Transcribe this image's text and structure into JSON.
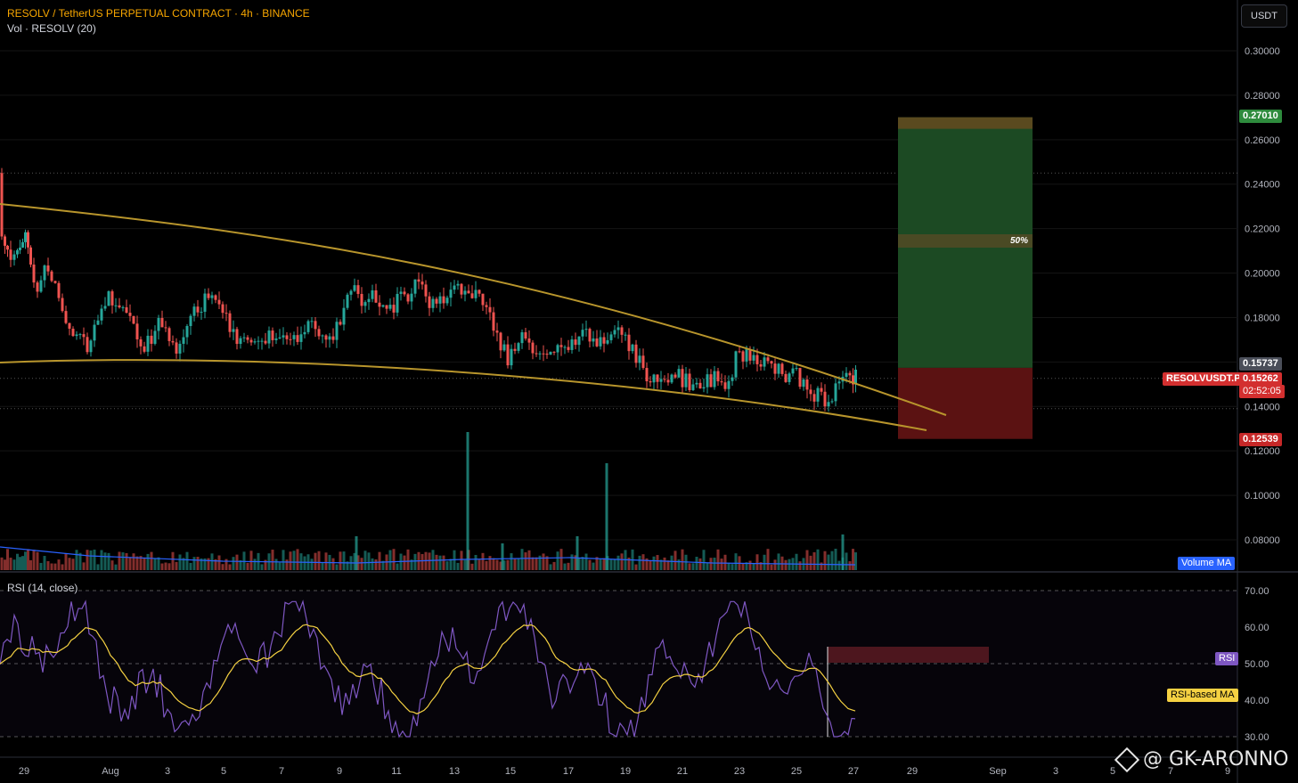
{
  "header": {
    "title": "RESOLV / TetherUS PERPETUAL CONTRACT · 4h · BINANCE",
    "volume_label": "Vol · RESOLV (20)",
    "rsi_label": "RSI (14, close)",
    "unit": "USDT"
  },
  "colors": {
    "up": "#26a69a",
    "down": "#ef5350",
    "trendline": "#b8952c",
    "rsi_line": "#7e57c2",
    "rsi_ma": "#f5d142",
    "target_zone": "#1c4a23",
    "stop_zone": "#5b1212"
  },
  "tags": {
    "target": "0.27010",
    "last_high": "0.15737",
    "symbol": "RESOLVUSDT.P",
    "last_price": "0.15262",
    "countdown": "02:52:05",
    "stop": "0.12539",
    "volume_ma": "Volume MA",
    "rsi": "RSI",
    "rsi_ma": "RSI-based MA",
    "mid_label": "50%"
  },
  "watermark": "@ GK-ARONNO",
  "chart_data": {
    "type": "candlestick",
    "symbol": "RESOLVUSDT.P",
    "interval": "4h",
    "y_ticks": [
      "0.30000",
      "0.28000",
      "0.26000",
      "0.24000",
      "0.22000",
      "0.20000",
      "0.18000",
      "0.16000",
      "0.14000",
      "0.12000",
      "0.10000",
      "0.08000"
    ],
    "ylim": [
      0.07,
      0.31
    ],
    "x_ticks": [
      "29",
      "Aug",
      "3",
      "5",
      "7",
      "9",
      "11",
      "13",
      "15",
      "17",
      "19",
      "21",
      "23",
      "25",
      "27",
      "29",
      "Sep",
      "3",
      "5",
      "7",
      "9"
    ],
    "price_path": [
      [
        0,
        0.245
      ],
      [
        4,
        0.22
      ],
      [
        10,
        0.212
      ],
      [
        18,
        0.205
      ],
      [
        24,
        0.21
      ],
      [
        30,
        0.218
      ],
      [
        36,
        0.2
      ],
      [
        44,
        0.192
      ],
      [
        52,
        0.205
      ],
      [
        60,
        0.198
      ],
      [
        68,
        0.188
      ],
      [
        76,
        0.18
      ],
      [
        84,
        0.175
      ],
      [
        92,
        0.17
      ],
      [
        100,
        0.168
      ],
      [
        108,
        0.178
      ],
      [
        116,
        0.184
      ],
      [
        124,
        0.188
      ],
      [
        132,
        0.186
      ],
      [
        140,
        0.182
      ],
      [
        148,
        0.178
      ],
      [
        156,
        0.17
      ],
      [
        164,
        0.168
      ],
      [
        172,
        0.172
      ],
      [
        180,
        0.176
      ],
      [
        188,
        0.172
      ],
      [
        196,
        0.165
      ],
      [
        204,
        0.168
      ],
      [
        212,
        0.178
      ],
      [
        220,
        0.182
      ],
      [
        228,
        0.186
      ],
      [
        236,
        0.19
      ],
      [
        244,
        0.188
      ],
      [
        252,
        0.18
      ],
      [
        260,
        0.176
      ],
      [
        268,
        0.172
      ],
      [
        276,
        0.171
      ],
      [
        284,
        0.17
      ],
      [
        292,
        0.168
      ],
      [
        300,
        0.17
      ],
      [
        308,
        0.172
      ],
      [
        316,
        0.17
      ],
      [
        324,
        0.168
      ],
      [
        332,
        0.169
      ],
      [
        340,
        0.172
      ],
      [
        348,
        0.178
      ],
      [
        356,
        0.176
      ],
      [
        364,
        0.172
      ],
      [
        372,
        0.168
      ],
      [
        380,
        0.175
      ],
      [
        388,
        0.186
      ],
      [
        396,
        0.194
      ],
      [
        404,
        0.19
      ],
      [
        412,
        0.188
      ],
      [
        420,
        0.192
      ],
      [
        428,
        0.184
      ],
      [
        436,
        0.182
      ],
      [
        444,
        0.186
      ],
      [
        452,
        0.19
      ],
      [
        460,
        0.188
      ],
      [
        468,
        0.194
      ],
      [
        476,
        0.195
      ],
      [
        484,
        0.188
      ],
      [
        492,
        0.184
      ],
      [
        500,
        0.188
      ],
      [
        508,
        0.19
      ],
      [
        516,
        0.192
      ],
      [
        524,
        0.193
      ],
      [
        532,
        0.19
      ],
      [
        540,
        0.192
      ],
      [
        548,
        0.186
      ],
      [
        556,
        0.178
      ],
      [
        564,
        0.166
      ],
      [
        572,
        0.162
      ],
      [
        580,
        0.168
      ],
      [
        588,
        0.17
      ],
      [
        596,
        0.166
      ],
      [
        604,
        0.164
      ],
      [
        612,
        0.166
      ],
      [
        620,
        0.165
      ],
      [
        628,
        0.164
      ],
      [
        636,
        0.166
      ],
      [
        644,
        0.168
      ],
      [
        652,
        0.17
      ],
      [
        660,
        0.172
      ],
      [
        668,
        0.17
      ],
      [
        676,
        0.168
      ],
      [
        684,
        0.172
      ],
      [
        692,
        0.174
      ],
      [
        700,
        0.172
      ],
      [
        708,
        0.168
      ],
      [
        716,
        0.162
      ],
      [
        724,
        0.158
      ],
      [
        732,
        0.152
      ],
      [
        740,
        0.15
      ],
      [
        748,
        0.152
      ],
      [
        756,
        0.151
      ],
      [
        764,
        0.153
      ],
      [
        772,
        0.152
      ],
      [
        780,
        0.15
      ],
      [
        788,
        0.152
      ],
      [
        796,
        0.151
      ],
      [
        804,
        0.152
      ],
      [
        812,
        0.15
      ],
      [
        820,
        0.152
      ],
      [
        828,
        0.162
      ],
      [
        836,
        0.164
      ],
      [
        844,
        0.162
      ],
      [
        852,
        0.16
      ],
      [
        860,
        0.162
      ],
      [
        868,
        0.16
      ],
      [
        876,
        0.156
      ],
      [
        884,
        0.154
      ],
      [
        892,
        0.156
      ],
      [
        900,
        0.152
      ],
      [
        908,
        0.148
      ],
      [
        916,
        0.146
      ],
      [
        924,
        0.144
      ],
      [
        932,
        0.142
      ],
      [
        940,
        0.148
      ],
      [
        948,
        0.156
      ],
      [
        956,
        0.153
      ],
      [
        962,
        0.1526
      ]
    ],
    "target_price": 0.2701,
    "entry_price": 0.15737,
    "last_price": 0.15262,
    "stop_price": 0.12539,
    "rsi_ticks": [
      "70.00",
      "60.00",
      "50.00",
      "40.00",
      "30.00"
    ],
    "rsi_ylim": [
      27,
      72
    ]
  }
}
